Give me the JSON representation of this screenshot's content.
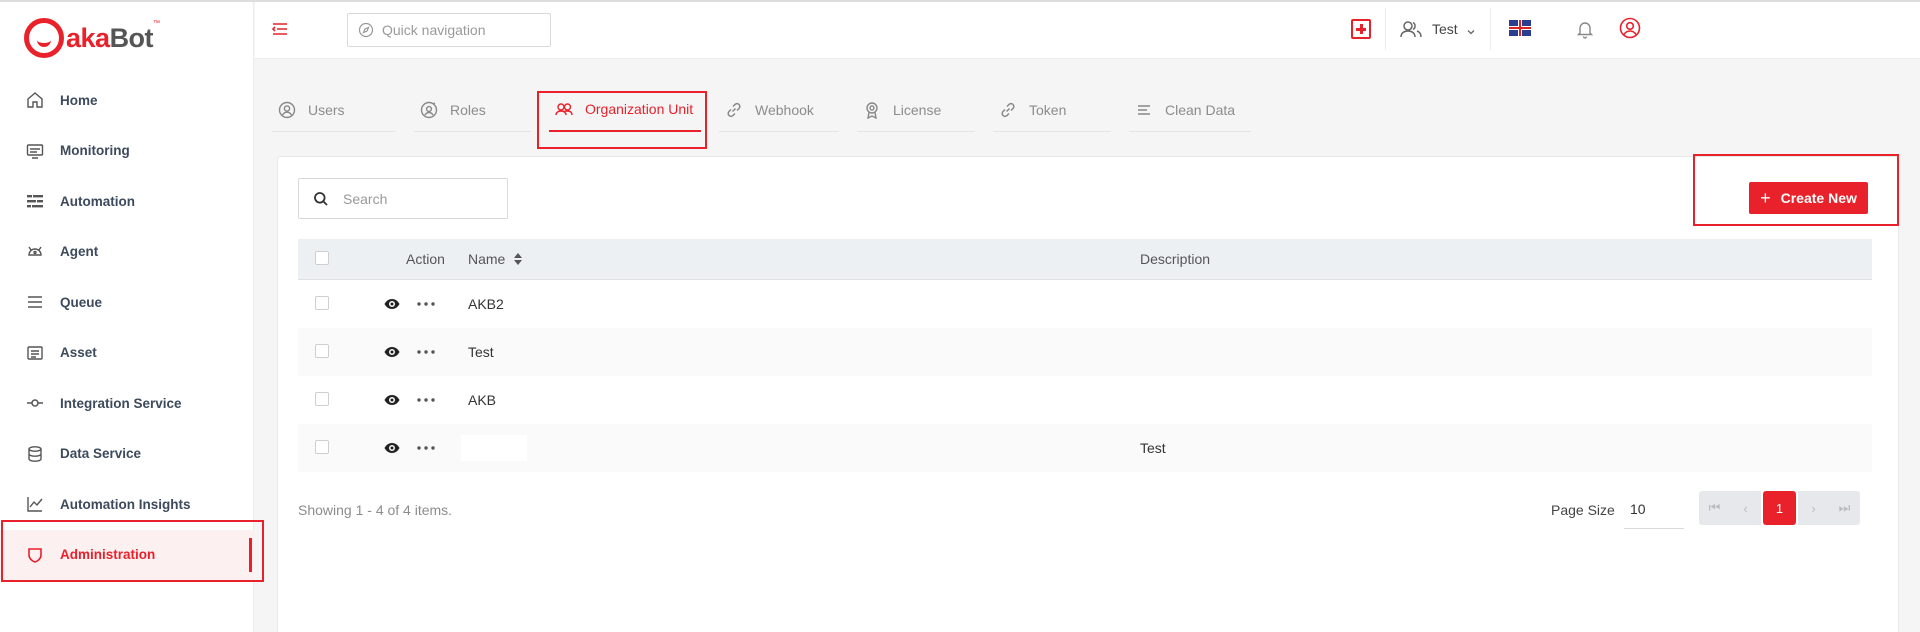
{
  "brand": {
    "logo_prefix": "akaBot",
    "logo_a": "aka",
    "logo_b": "Bot",
    "tm": "™",
    "accent": "#e8212b"
  },
  "sidebar": {
    "items": [
      {
        "label": "Home",
        "icon": "home-icon"
      },
      {
        "label": "Monitoring",
        "icon": "monitor-icon"
      },
      {
        "label": "Automation",
        "icon": "automation-icon"
      },
      {
        "label": "Agent",
        "icon": "agent-icon"
      },
      {
        "label": "Queue",
        "icon": "queue-icon"
      },
      {
        "label": "Asset",
        "icon": "asset-icon"
      },
      {
        "label": "Integration Service",
        "icon": "integration-icon"
      },
      {
        "label": "Data Service",
        "icon": "database-icon"
      },
      {
        "label": "Automation Insights",
        "icon": "chart-icon"
      },
      {
        "label": "Administration",
        "icon": "shield-icon",
        "active": true
      }
    ]
  },
  "topbar": {
    "quicknav_placeholder": "Quick navigation",
    "user_name": "Test",
    "language": "English (UK)"
  },
  "tabs": [
    {
      "label": "Users",
      "icon": "user-icon"
    },
    {
      "label": "Roles",
      "icon": "roles-icon"
    },
    {
      "label": "Organization Unit",
      "icon": "org-unit-icon",
      "active": true
    },
    {
      "label": "Webhook",
      "icon": "link-icon"
    },
    {
      "label": "License",
      "icon": "license-icon"
    },
    {
      "label": "Token",
      "icon": "link-icon"
    },
    {
      "label": "Clean Data",
      "icon": "clean-icon"
    }
  ],
  "toolbar": {
    "search_placeholder": "Search",
    "create_label": "Create New"
  },
  "table": {
    "columns": {
      "action": "Action",
      "name": "Name",
      "description": "Description"
    },
    "rows": [
      {
        "name": "AKB2",
        "description": ""
      },
      {
        "name": "Test",
        "description": ""
      },
      {
        "name": "AKB",
        "description": ""
      },
      {
        "name": "",
        "description": "Test"
      }
    ]
  },
  "footer": {
    "showing": "Showing 1 - 4 of 4 items.",
    "page_size_label": "Page Size",
    "page_size": "10",
    "current_page": "1"
  }
}
